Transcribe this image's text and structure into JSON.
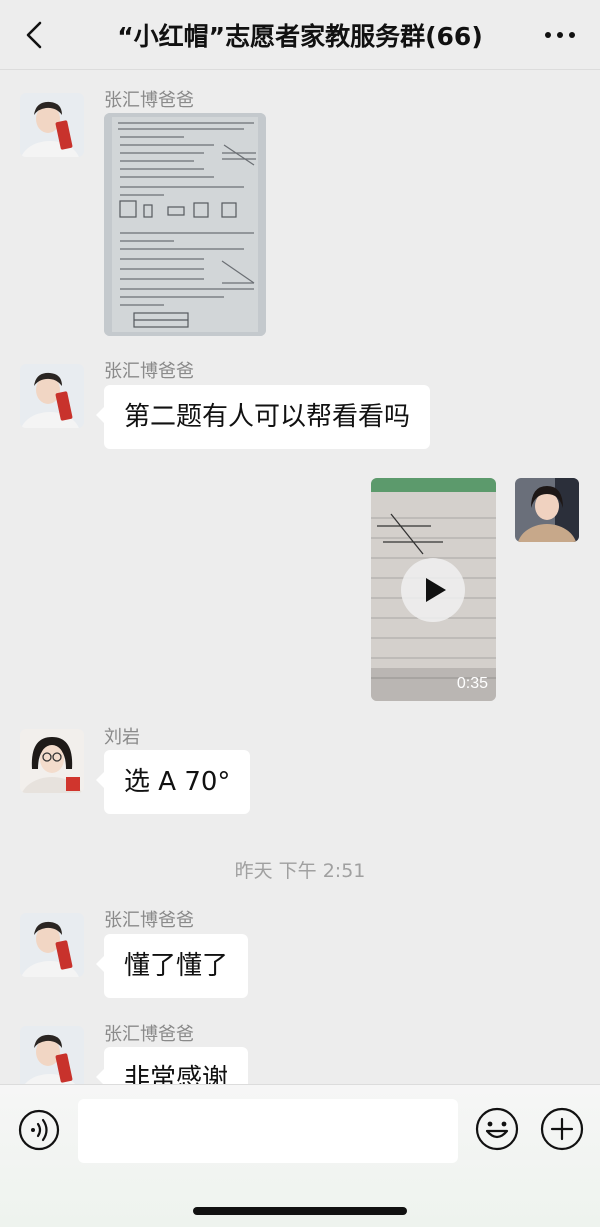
{
  "header": {
    "title": "“小红帽”志愿者家教服务群(66)",
    "back_icon": "chevron-left-icon",
    "more_icon": "more-dots-icon"
  },
  "messages": [
    {
      "sender": "张汇博爸爸",
      "type": "image",
      "content": "试卷照片"
    },
    {
      "sender": "张汇博爸爸",
      "type": "text",
      "text": "第二题有人可以帮看看吗"
    },
    {
      "sender": "",
      "type": "video",
      "duration": "0:35",
      "self": true
    },
    {
      "sender": "刘岩",
      "type": "text",
      "text": "选 A 70°"
    },
    {
      "sender": "张汇博爸爸",
      "type": "text",
      "text": "懂了懂了"
    },
    {
      "sender": "张汇博爸爸",
      "type": "text",
      "text": "非常感谢"
    }
  ],
  "timestamp": "昨天 下午 2:51",
  "input_bar": {
    "voice_icon": "voice-icon",
    "emoji_icon": "emoji-icon",
    "plus_icon": "plus-icon",
    "input_value": ""
  },
  "colors": {
    "background": "#ededed",
    "bubble": "#ffffff",
    "sender": "#8a8a8a"
  }
}
